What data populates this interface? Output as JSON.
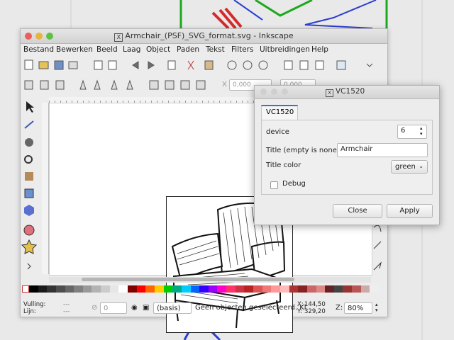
{
  "window": {
    "title": "Armchair_(PSF)_SVG_format.svg - Inkscape"
  },
  "menubar": [
    "Bestand",
    "Bewerken",
    "Beeld",
    "Laag",
    "Object",
    "Paden",
    "Tekst",
    "Filters",
    "Uitbreidingen",
    "Help"
  ],
  "toolbar": {
    "x_label": "X",
    "x_value": "0,000",
    "y_value": "0,000"
  },
  "status": {
    "fill_label": "Vulling:",
    "stroke_label": "Lijn:",
    "fill_value": "---",
    "stroke_value": "---",
    "opacity_value": "0",
    "layer_value": "(basis)",
    "message": "Geen objecten geselecteerd. Kl",
    "coord_x_label": "X:",
    "coord_y_label": "Y:",
    "coord_x": "144,50",
    "coord_y": "329,20",
    "zoom_label": "Z:",
    "zoom_value": "80%"
  },
  "dialog": {
    "title": "VC1520",
    "tab": "VC1520",
    "device_label": "device",
    "device_value": "6",
    "title_label": "Title (empty is none)",
    "title_value": "Armchair",
    "color_label": "Title color",
    "color_value": "green",
    "debug_label": "Debug",
    "close_label": "Close",
    "apply_label": "Apply"
  },
  "colors": {
    "accent": "#3b73c6",
    "bg_green": "#1ea81e",
    "bg_blue": "#2b3fd0",
    "bg_red": "#d42a2a"
  }
}
